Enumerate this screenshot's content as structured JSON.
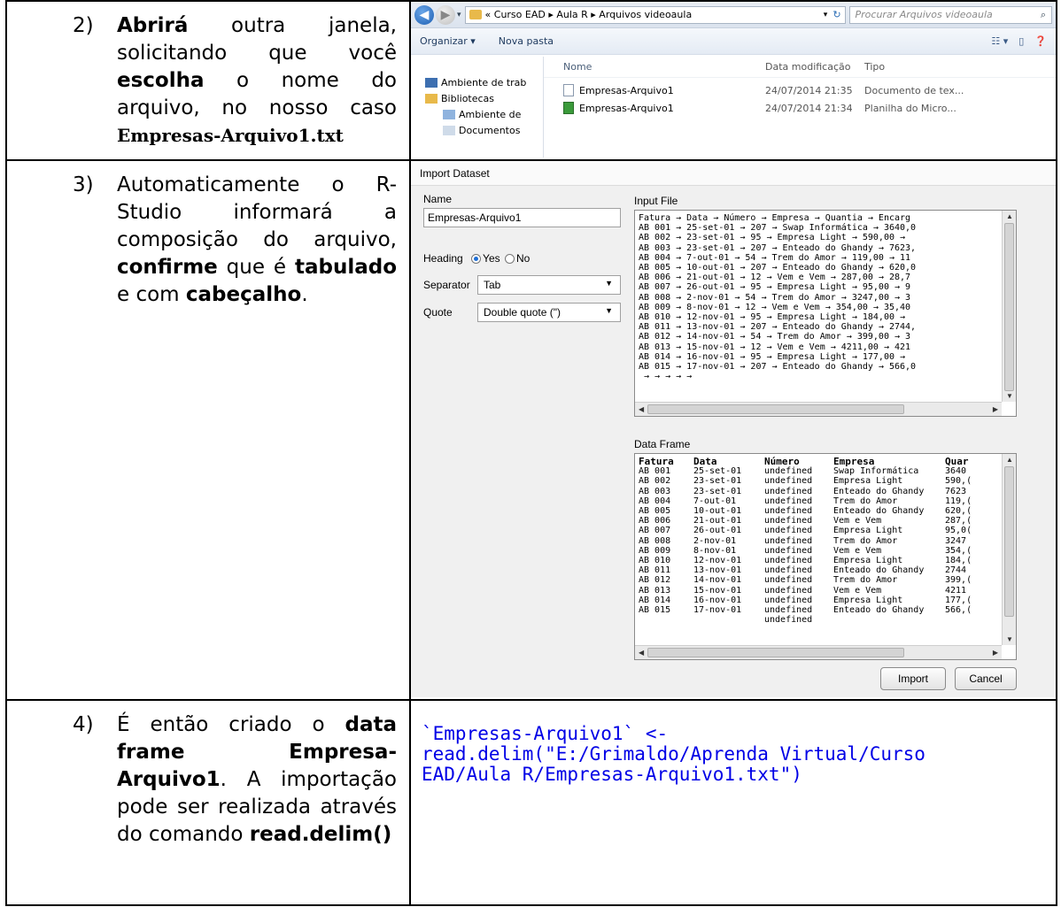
{
  "row1": {
    "num": "2)",
    "w1": "Abrirá",
    "t1": " outra janela, solicitando que você ",
    "w2": "escolha",
    "t2": " o nome do arquivo, no nosso caso ",
    "w3": "Empresas-Arquivo1.txt",
    "explorer": {
      "path": "« Curso EAD ▸ Aula R ▸ Arquivos videoaula",
      "search_placeholder": "Procurar Arquivos videoaula",
      "organize": "Organizar ▾",
      "new_folder": "Nova pasta",
      "nav_items": [
        "Ambiente de trab",
        "Bibliotecas",
        "Ambiente de",
        "Documentos"
      ],
      "col_name": "Nome",
      "col_date": "Data modificação",
      "col_type": "Tipo",
      "files": [
        {
          "name": "Empresas-Arquivo1",
          "date": "24/07/2014 21:35",
          "type": "Documento de tex..."
        },
        {
          "name": "Empresas-Arquivo1",
          "date": "24/07/2014 21:34",
          "type": "Planilha do Micro..."
        }
      ]
    }
  },
  "row2": {
    "num": "3)",
    "t1": "Automaticamente o R-Studio informará a composição do arquivo, ",
    "w1": "confirme",
    "t2": " que é ",
    "w2": "tabulado",
    "t3": " e com ",
    "w3": "cabeçalho",
    "t4": ".",
    "dialog": {
      "title": "Import Dataset",
      "name_label": "Name",
      "name_value": "Empresas-Arquivo1",
      "heading_label": "Heading",
      "yes": "Yes",
      "no": "No",
      "separator_label": "Separator",
      "separator_value": "Tab",
      "quote_label": "Quote",
      "quote_value": "Double quote (\")",
      "input_file_label": "Input File",
      "input_file_text": "Fatura → Data → Número → Empresa → Quantia → Encarg\nAB 001 → 25-set-01 → 207 → Swap Informática → 3640,0\nAB 002 → 23-set-01 → 95 → Empresa Light → 590,00 →\nAB 003 → 23-set-01 → 207 → Enteado do Ghandy → 7623,\nAB 004 → 7-out-01 → 54 → Trem do Amor → 119,00 → 11\nAB 005 → 10-out-01 → 207 → Enteado do Ghandy → 620,0\nAB 006 → 21-out-01 → 12 → Vem e Vem → 287,00 → 28,7\nAB 007 → 26-out-01 → 95 → Empresa Light → 95,00 → 9\nAB 008 → 2-nov-01 → 54 → Trem do Amor → 3247,00 → 3\nAB 009 → 8-nov-01 → 12 → Vem e Vem → 354,00 → 35,40\nAB 010 → 12-nov-01 → 95 → Empresa Light → 184,00 →\nAB 011 → 13-nov-01 → 207 → Enteado do Ghandy → 2744,\nAB 012 → 14-nov-01 → 54 → Trem do Amor → 399,00 → 3\nAB 013 → 15-nov-01 → 12 → Vem e Vem → 4211,00 → 421\nAB 014 → 16-nov-01 → 95 → Empresa Light → 177,00 →\nAB 015 → 17-nov-01 → 207 → Enteado do Ghandy → 566,0\n → → → → →",
      "data_frame_label": "Data Frame",
      "df_columns": [
        "Fatura",
        "Data",
        "Número",
        "Empresa",
        "Quar"
      ],
      "df_rows": [
        [
          "AB 001",
          "25-set-01",
          "undefined",
          "Swap Informática",
          "3640"
        ],
        [
          "AB 002",
          "23-set-01",
          "undefined",
          "Empresa Light",
          "590,("
        ],
        [
          "AB 003",
          "23-set-01",
          "undefined",
          "Enteado do Ghandy",
          "7623"
        ],
        [
          "AB 004",
          "7-out-01",
          "undefined",
          "Trem do Amor",
          "119,("
        ],
        [
          "AB 005",
          "10-out-01",
          "undefined",
          "Enteado do Ghandy",
          "620,("
        ],
        [
          "AB 006",
          "21-out-01",
          "undefined",
          "Vem e Vem",
          "287,("
        ],
        [
          "AB 007",
          "26-out-01",
          "undefined",
          "Empresa Light",
          "95,0("
        ],
        [
          "AB 008",
          "2-nov-01",
          "undefined",
          "Trem do Amor",
          "3247"
        ],
        [
          "AB 009",
          "8-nov-01",
          "undefined",
          "Vem e Vem",
          "354,("
        ],
        [
          "AB 010",
          "12-nov-01",
          "undefined",
          "Empresa Light",
          "184,("
        ],
        [
          "AB 011",
          "13-nov-01",
          "undefined",
          "Enteado do Ghandy",
          "2744"
        ],
        [
          "AB 012",
          "14-nov-01",
          "undefined",
          "Trem do Amor",
          "399,("
        ],
        [
          "AB 013",
          "15-nov-01",
          "undefined",
          "Vem e Vem",
          "4211"
        ],
        [
          "AB 014",
          "16-nov-01",
          "undefined",
          "Empresa Light",
          "177,("
        ],
        [
          "AB 015",
          "17-nov-01",
          "undefined",
          "Enteado do Ghandy",
          "566,("
        ],
        [
          "",
          "",
          "undefined",
          "",
          ""
        ]
      ],
      "import_button": "Import",
      "cancel_button": "Cancel"
    }
  },
  "row3": {
    "num": "4)",
    "t1": "É então criado o ",
    "w1": "data frame Empresa-Arquivo1",
    "t2": ". A importação pode ser realizada através do comando ",
    "w2": "read.delim()",
    "code": "`Empresas-Arquivo1` <-\nread.delim(\"E:/Grimaldo/Aprenda Virtual/Curso\nEAD/Aula R/Empresas-Arquivo1.txt\")"
  }
}
